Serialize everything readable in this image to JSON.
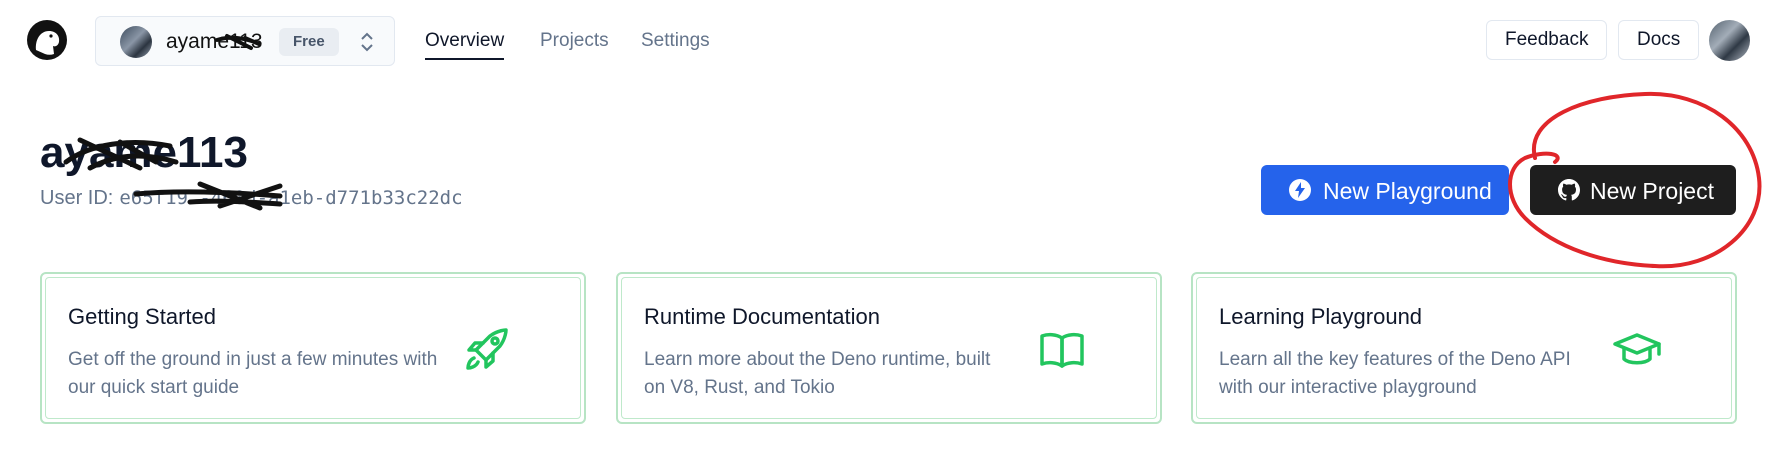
{
  "account": {
    "name": "ayame113",
    "plan_badge": "Free"
  },
  "nav": {
    "overview": "Overview",
    "projects": "Projects",
    "settings": "Settings"
  },
  "top_buttons": {
    "feedback": "Feedback",
    "docs": "Docs"
  },
  "user": {
    "display_name": "ayame113",
    "id_label": "User ID:",
    "id_value": "e65f19…-460d-a1eb-d771b33c22dc"
  },
  "actions": {
    "new_playground": "New Playground",
    "new_project": "New Project"
  },
  "cards": [
    {
      "title": "Getting Started",
      "description": "Get off the ground in just a few minutes with our quick start guide",
      "icon": "rocket-icon"
    },
    {
      "title": "Runtime Documentation",
      "description": "Learn more about the Deno runtime, built on V8, Rust, and Tokio",
      "icon": "book-icon"
    },
    {
      "title": "Learning Playground",
      "description": "Learn all the key features of the Deno API with our interactive playground",
      "icon": "graduation-cap-icon"
    }
  ],
  "colors": {
    "primary": "#2563eb",
    "dark_button": "#1e1e1e",
    "accent_green": "#22c55e",
    "annotation_red": "#e0262a"
  }
}
